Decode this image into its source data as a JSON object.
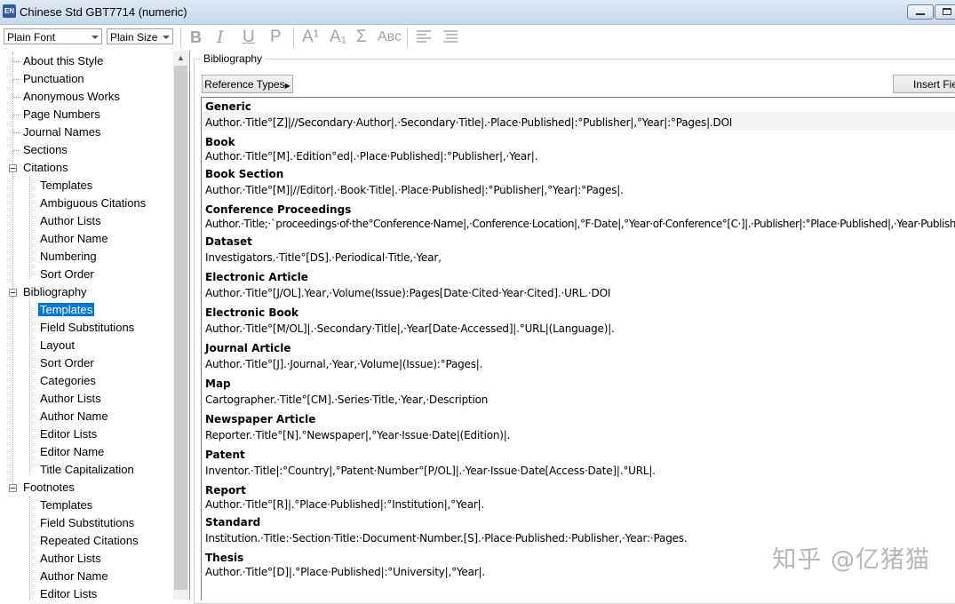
{
  "window": {
    "title": "Chinese Std GBT7714 (numeric)",
    "app_icon_text": "EN"
  },
  "toolbar": {
    "font_value": "Plain Font",
    "size_value": "Plain Size",
    "bold": "B",
    "italic": "I",
    "underline": "U",
    "plain": "P",
    "superscript": "A¹",
    "subscript": "A₁",
    "symbol": "Σ",
    "smallcaps": "Aʙᴄ"
  },
  "tree": {
    "items": [
      {
        "label": "About this Style"
      },
      {
        "label": "Punctuation"
      },
      {
        "label": "Anonymous Works"
      },
      {
        "label": "Page Numbers"
      },
      {
        "label": "Journal Names"
      },
      {
        "label": "Sections"
      },
      {
        "label": "Citations"
      },
      {
        "label": "Templates"
      },
      {
        "label": "Ambiguous Citations"
      },
      {
        "label": "Author Lists"
      },
      {
        "label": "Author Name"
      },
      {
        "label": "Numbering"
      },
      {
        "label": "Sort Order"
      },
      {
        "label": "Bibliography"
      },
      {
        "label": "Templates"
      },
      {
        "label": "Field Substitutions"
      },
      {
        "label": "Layout"
      },
      {
        "label": "Sort Order"
      },
      {
        "label": "Categories"
      },
      {
        "label": "Author Lists"
      },
      {
        "label": "Author Name"
      },
      {
        "label": "Editor Lists"
      },
      {
        "label": "Editor Name"
      },
      {
        "label": "Title Capitalization"
      },
      {
        "label": "Footnotes"
      },
      {
        "label": "Templates"
      },
      {
        "label": "Field Substitutions"
      },
      {
        "label": "Repeated Citations"
      },
      {
        "label": "Author Lists"
      },
      {
        "label": "Author Name"
      },
      {
        "label": "Editor Lists"
      }
    ]
  },
  "panel": {
    "group_label": "Bibliography",
    "reference_types_button": "Reference Types",
    "insert_field_button": "Insert Fie"
  },
  "references": [
    {
      "type": "Generic",
      "template": "Author.·Title°[Z]|//Secondary·Author|.·Secondary·Title|.·Place·Published|:°Publisher|,°Year|:°Pages|.DOI"
    },
    {
      "type": "Book",
      "template": "Author.·Title°[M].·Edition°ed|.·Place·Published|:°Publisher|,·Year|."
    },
    {
      "type": "Book Section",
      "template": "Author.·Title°[M]|//Editor|.·Book·Title|.·Place·Published|:°Publisher|,°Year|:°Pages|."
    },
    {
      "type": "Conference Proceedings",
      "template": "Author.·Title;·`proceedings·of·the°Conference·Name|,·Conference·Location|,°F·Date|,°Year·of·Conference°[C·]|.·Publisher|:°Place·Published|,·Year·Published|."
    },
    {
      "type": "Dataset",
      "template": "Investigators.·Title°[DS].·Periodical·Title,·Year,"
    },
    {
      "type": "Electronic Article",
      "template": "Author.·Title°[J/OL].Year,·Volume(Issue):Pages[Date·Cited·Year·Cited].·URL.·DOI"
    },
    {
      "type": "Electronic Book",
      "template": "Author.·Title°[M/OL]|.·Secondary·Title|,·Year[Date·Accessed]|.°URL|(Language)|."
    },
    {
      "type": "Journal Article",
      "template": "Author.·Title°[J].·Journal,·Year,·Volume|(Issue):°Pages|."
    },
    {
      "type": "Map",
      "template": "Cartographer.·Title°[CM].·Series·Title,·Year,·Description"
    },
    {
      "type": "Newspaper Article",
      "template": "Reporter.·Title°[N].°Newspaper|,°Year·Issue·Date|(Edition)|."
    },
    {
      "type": "Patent",
      "template": "Inventor.·Title|:°Country|,°Patent·Number°[P/OL]|.·Year·Issue·Date[Access·Date]|.°URL|."
    },
    {
      "type": "Report",
      "template": "Author.·Title°[R]|.°Place·Published|:°Institution|,°Year|."
    },
    {
      "type": "Standard",
      "template": "Institution.·Title:·Section·Title:·Document·Number.[S].·Place·Published:·Publisher,·Year:·Pages."
    },
    {
      "type": "Thesis",
      "template": "Author.·Title°[D]|.°Place·Published|:°University|,°Year|."
    }
  ],
  "watermark": "知乎 @亿猪猫",
  "colors": {
    "selection": "#0078d7",
    "titlebar": "#dfe9f5"
  }
}
